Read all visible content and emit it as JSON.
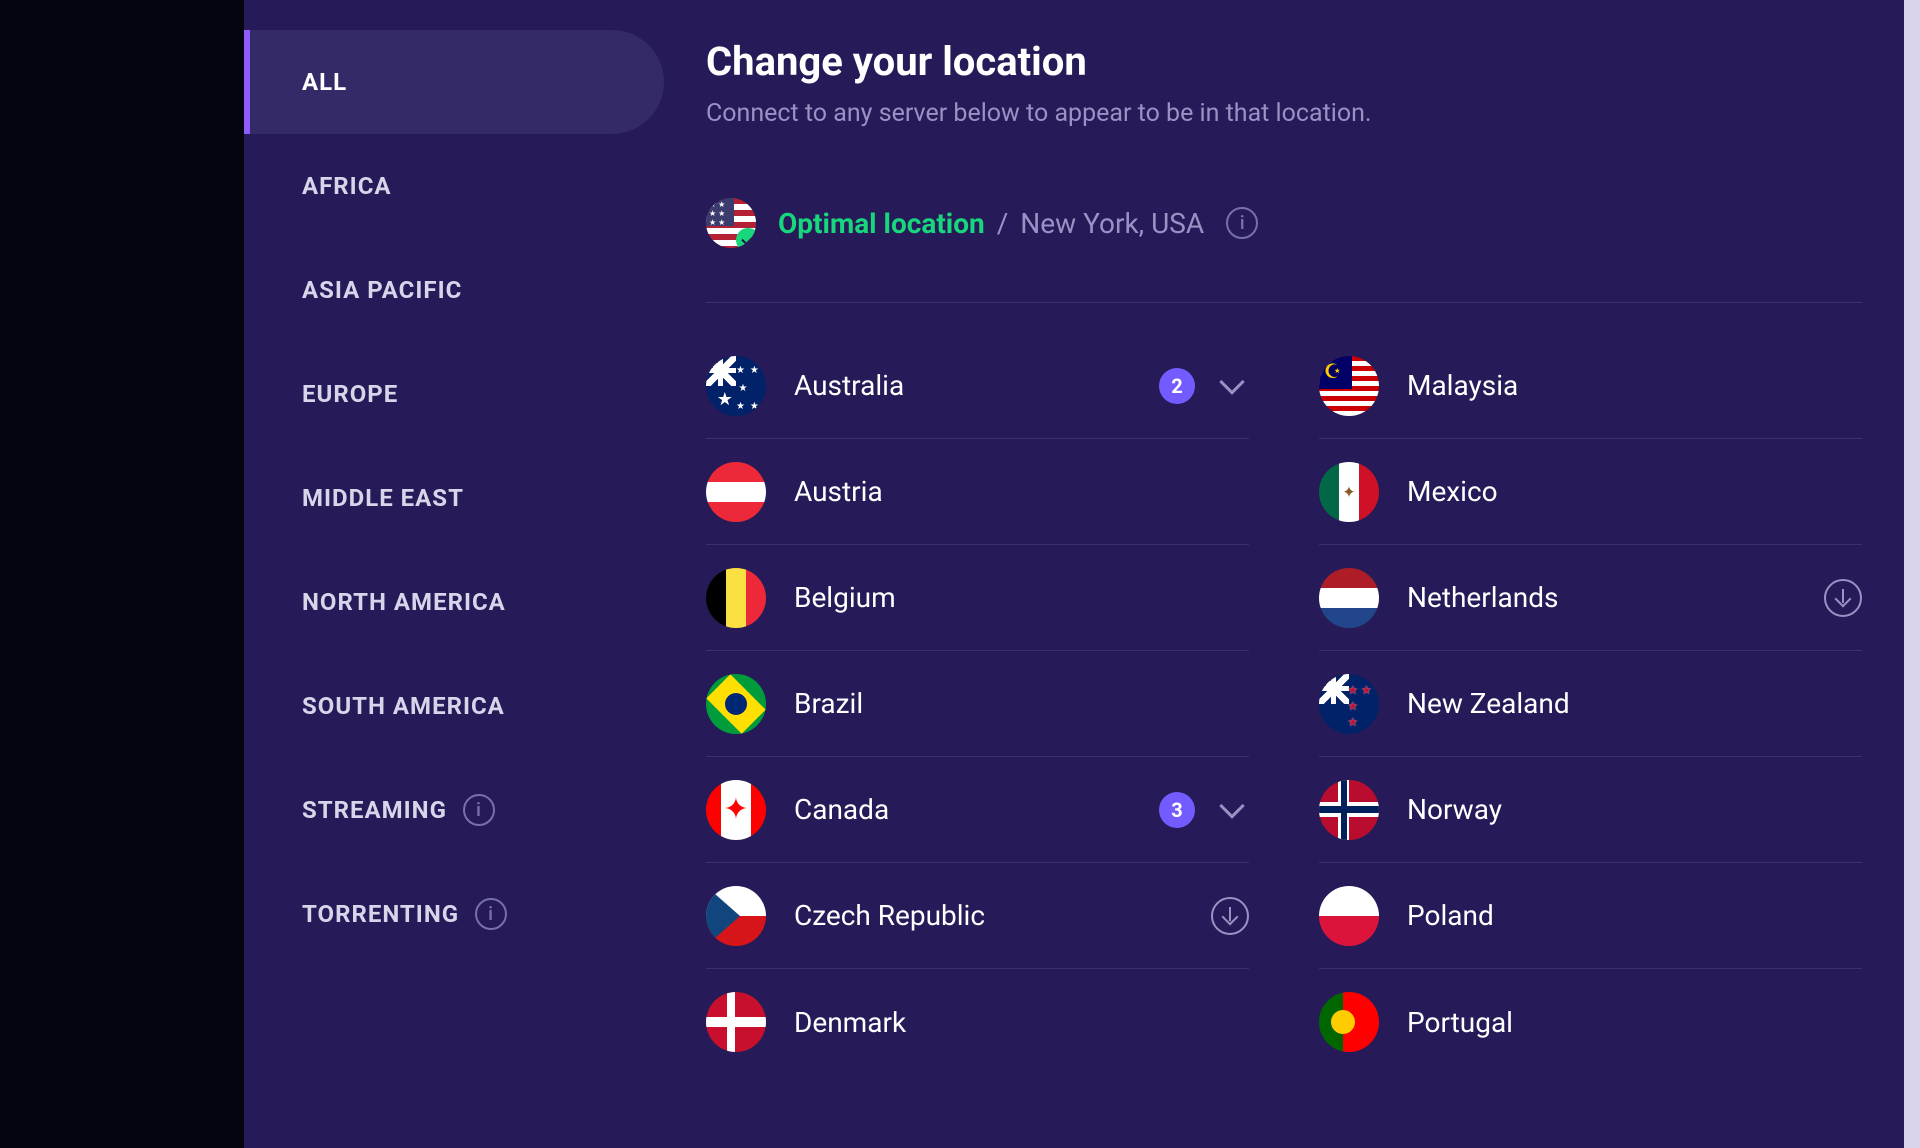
{
  "sidebar": {
    "items": [
      {
        "label": "ALL",
        "active": true
      },
      {
        "label": "AFRICA"
      },
      {
        "label": "ASIA PACIFIC"
      },
      {
        "label": "EUROPE"
      },
      {
        "label": "MIDDLE EAST"
      },
      {
        "label": "NORTH AMERICA"
      },
      {
        "label": "SOUTH AMERICA"
      },
      {
        "label": "STREAMING",
        "info": true
      },
      {
        "label": "TORRENTING",
        "info": true
      }
    ]
  },
  "header": {
    "title": "Change your location",
    "subtitle": "Connect to any server below to appear to be in that location."
  },
  "optimal": {
    "label": "Optimal location",
    "separator": "/",
    "location": "New York, USA",
    "flag": "usa"
  },
  "locations": {
    "col1": [
      {
        "name": "Australia",
        "flag": "au",
        "count": "2",
        "expandable": true
      },
      {
        "name": "Austria",
        "flag": "at"
      },
      {
        "name": "Belgium",
        "flag": "be"
      },
      {
        "name": "Brazil",
        "flag": "br"
      },
      {
        "name": "Canada",
        "flag": "ca",
        "count": "3",
        "expandable": true
      },
      {
        "name": "Czech Republic",
        "flag": "cz",
        "download": true
      },
      {
        "name": "Denmark",
        "flag": "dk"
      }
    ],
    "col2": [
      {
        "name": "Malaysia",
        "flag": "my"
      },
      {
        "name": "Mexico",
        "flag": "mx"
      },
      {
        "name": "Netherlands",
        "flag": "nl",
        "download": true
      },
      {
        "name": "New Zealand",
        "flag": "nz"
      },
      {
        "name": "Norway",
        "flag": "no"
      },
      {
        "name": "Poland",
        "flag": "pl"
      },
      {
        "name": "Portugal",
        "flag": "pt"
      }
    ]
  }
}
